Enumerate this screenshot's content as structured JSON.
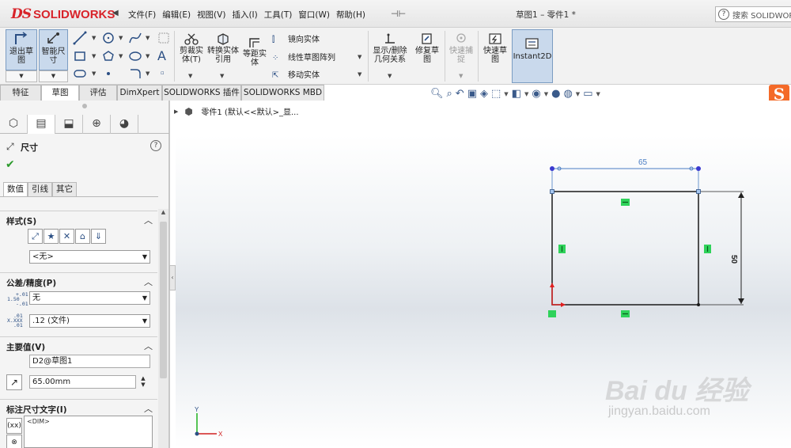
{
  "app": {
    "logo_text": "SOLIDWORKS",
    "logo_ds": "DS",
    "doc_title": "草图1 – 零件1 *",
    "search_placeholder": "搜索 SOLIDWORKS",
    "menu": [
      "文件(F)",
      "编辑(E)",
      "视图(V)",
      "插入(I)",
      "工具(T)",
      "窗口(W)",
      "帮助(H)"
    ]
  },
  "commands": {
    "exit_sketch": "退出草图",
    "smart_dim": "智能尺寸",
    "trim": "剪裁实体(T)",
    "convert": "转换实体引用",
    "offset": "等距实体",
    "mirror": "镜向实体",
    "linear_pattern": "线性草图阵列",
    "move": "移动实体",
    "relations": "显示/删除几何关系",
    "repair": "修复草图",
    "quick_snaps": "快速捕捉",
    "rapid_sketch": "快速草图",
    "instant2d": "Instant2D"
  },
  "tabs": [
    {
      "label": "特征",
      "active": false
    },
    {
      "label": "草图",
      "active": true
    },
    {
      "label": "评估",
      "active": false
    },
    {
      "label": "DimXpert",
      "active": false
    },
    {
      "label": "SOLIDWORKS 插件",
      "active": false
    },
    {
      "label": "SOLIDWORKS MBD",
      "active": false
    }
  ],
  "property_manager": {
    "title": "尺寸",
    "subtabs": [
      "数值",
      "引线",
      "其它"
    ],
    "groups": {
      "style": "样式(S)",
      "tolerance": "公差/精度(P)",
      "primary": "主要值(V)",
      "dim_text": "标注尺寸文字(I)"
    },
    "style_select": "<无>",
    "tolerance_type": "无",
    "precision": ".12 (文件)",
    "primary_name": "D2@草图1",
    "primary_value": "65.00mm",
    "dim_text_value": "<DIM>",
    "tol_icon_1": "1.50",
    "tol_icon_1_top": "+.01",
    "tol_icon_1_bot": "-.01",
    "tol_icon_2": "X.XXX",
    "tol_icon_2_top": ".01",
    "tol_icon_2_bot": ".01"
  },
  "feature_tree": {
    "root": "零件1  (默认<<默认>_显..."
  },
  "sketch": {
    "dim_horizontal": "65",
    "dim_vertical": "50",
    "axis_x": "X",
    "axis_y": "Y"
  },
  "watermark": {
    "main": "Bai du 经验",
    "sub": "jingyan.baidu.com"
  },
  "colors": {
    "brand_red": "#d8232a",
    "sketch_blue": "#4a7ec4",
    "relation_green": "#2fd25a",
    "active_button": "#c9d9ec"
  }
}
